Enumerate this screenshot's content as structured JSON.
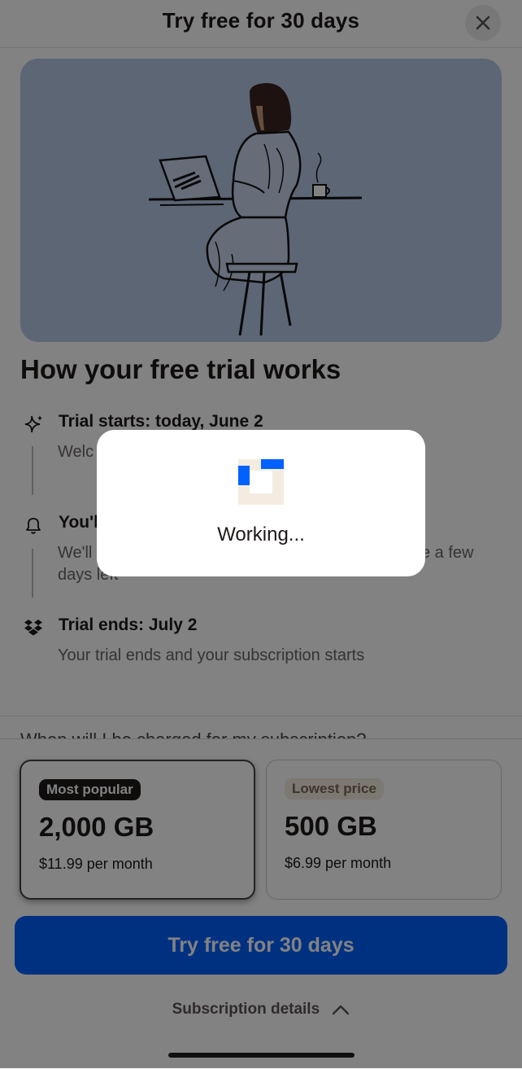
{
  "header": {
    "title": "Try free for 30 days",
    "close_icon": "close-icon"
  },
  "trial": {
    "heading": "How your free trial works",
    "steps": [
      {
        "icon": "sparkle-icon",
        "title": "Trial starts: today, June 2",
        "desc": "Welc"
      },
      {
        "icon": "bell-icon",
        "title": "You'l",
        "desc": "We'll",
        "desc_right": "e a few",
        "desc2": "days left"
      },
      {
        "icon": "dropbox-icon",
        "title": "Trial ends: July 2",
        "desc": "Your trial ends and your subscription starts"
      }
    ],
    "cutoff_text": "When will I be charged for my subscription?"
  },
  "plans": [
    {
      "badge": "Most popular",
      "size": "2,000 GB",
      "price": "$11.99 per month",
      "selected": true
    },
    {
      "badge": "Lowest price",
      "size": "500 GB",
      "price": "$6.99 per month",
      "selected": false
    }
  ],
  "cta": {
    "label": "Try free for 30 days"
  },
  "subscription_details": {
    "label": "Subscription details",
    "icon": "chevron-up-icon"
  },
  "modal": {
    "text": "Working...",
    "icon": "dropbox-loading-icon"
  },
  "colors": {
    "accent": "#0061fe",
    "hero_bg": "#b6c8e6",
    "text": "#1e1919"
  }
}
